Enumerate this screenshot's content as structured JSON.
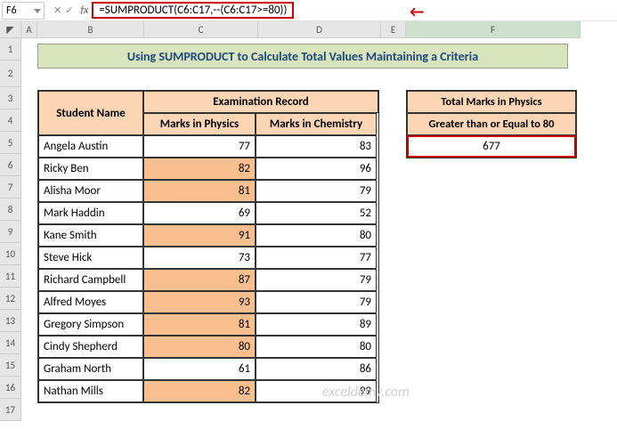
{
  "nameBox": "F6",
  "formula": "=SUMPRODUCT(C6:C17,--(C6:C17>=80))",
  "columns": [
    "A",
    "B",
    "C",
    "D",
    "E",
    "F"
  ],
  "rows": [
    "1",
    "2",
    "3",
    "4",
    "5",
    "6",
    "7",
    "8",
    "9",
    "10",
    "11",
    "12",
    "13",
    "14",
    "15",
    "16",
    "17"
  ],
  "title": "Using SUMPRODUCT to Calculate Total Values Maintaining a Criteria",
  "headers": {
    "studentName": "Student Name",
    "examRecord": "Examination Record",
    "physics": "Marks in Physics",
    "chemistry": "Marks in Chemistry"
  },
  "students": [
    {
      "name": "Angela Austin",
      "phys": 77,
      "chem": 83,
      "hl": false
    },
    {
      "name": "Ricky Ben",
      "phys": 82,
      "chem": 96,
      "hl": true
    },
    {
      "name": "Alisha Moor",
      "phys": 81,
      "chem": 79,
      "hl": true
    },
    {
      "name": "Mark Haddin",
      "phys": 69,
      "chem": 52,
      "hl": false
    },
    {
      "name": "Kane Smith",
      "phys": 91,
      "chem": 80,
      "hl": true
    },
    {
      "name": "Steve Hick",
      "phys": 73,
      "chem": 77,
      "hl": false
    },
    {
      "name": "Richard Campbell",
      "phys": 87,
      "chem": 79,
      "hl": true
    },
    {
      "name": "Alfred Moyes",
      "phys": 93,
      "chem": 79,
      "hl": true
    },
    {
      "name": "Gregory Simpson",
      "phys": 81,
      "chem": 89,
      "hl": true
    },
    {
      "name": "Cindy Shepherd",
      "phys": 80,
      "chem": 80,
      "hl": true
    },
    {
      "name": "Graham North",
      "phys": 61,
      "chem": 86,
      "hl": false
    },
    {
      "name": "Nathan Mills",
      "phys": 82,
      "chem": 99,
      "hl": true
    }
  ],
  "side": {
    "line1": "Total Marks in Physics",
    "line2": "Greater than or Equal to 80",
    "result": "677"
  },
  "watermark": "exceldemy.com",
  "chart_data": {
    "type": "table",
    "title": "Using SUMPRODUCT to Calculate Total Values Maintaining a Criteria",
    "columns": [
      "Student Name",
      "Marks in Physics",
      "Marks in Chemistry"
    ],
    "rows": [
      [
        "Angela Austin",
        77,
        83
      ],
      [
        "Ricky Ben",
        82,
        96
      ],
      [
        "Alisha Moor",
        81,
        79
      ],
      [
        "Mark Haddin",
        69,
        52
      ],
      [
        "Kane Smith",
        91,
        80
      ],
      [
        "Steve Hick",
        73,
        77
      ],
      [
        "Richard Campbell",
        87,
        79
      ],
      [
        "Alfred Moyes",
        93,
        79
      ],
      [
        "Gregory Simpson",
        81,
        89
      ],
      [
        "Cindy Shepherd",
        80,
        80
      ],
      [
        "Graham North",
        61,
        86
      ],
      [
        "Nathan Mills",
        82,
        99
      ]
    ],
    "summary": {
      "label": "Total Marks in Physics Greater than or Equal to 80",
      "value": 677
    }
  }
}
